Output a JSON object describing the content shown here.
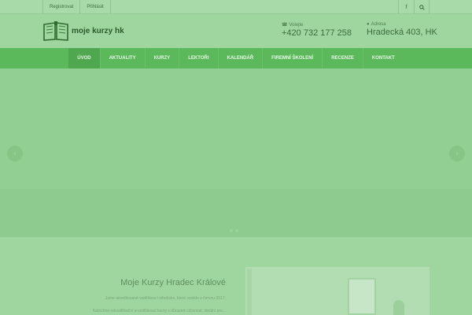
{
  "topbar": {
    "links": [
      "Registrovat",
      "Přihlásit"
    ],
    "icons": [
      "facebook-icon",
      "search-icon"
    ]
  },
  "logo": {
    "text": "moje kurzy hk"
  },
  "contacts": [
    {
      "label": "Volejte",
      "value": "+420 732 177 258",
      "icon": "phone-icon"
    },
    {
      "label": "Adresa",
      "value": "Hradecká 403, HK",
      "icon": "map-marker-icon"
    }
  ],
  "nav": {
    "items": [
      "ÚVOD",
      "AKTUALITY",
      "KURZY",
      "LEKTOŘI",
      "KALENDÁŘ",
      "FIREMNÍ ŠKOLENÍ",
      "RECENZE",
      "KONTAKT"
    ],
    "active": "ÚVOD"
  },
  "slider": {
    "prev": "‹",
    "next": "›",
    "dot_count": 2
  },
  "intro": {
    "title": "Moje Kurzy Hradec Králové",
    "line1": "Jsme akreditované vzdělávací středisko, které vzniklo v červnu 2017.",
    "line2": "Nabízíme rekvalifikační a vzdělávací kurzy s důrazem účinnost, ideální pro..."
  },
  "colors": {
    "nav": "#5bb85b",
    "background": "#9fd69f",
    "accent_text": "#2c5a2c"
  }
}
